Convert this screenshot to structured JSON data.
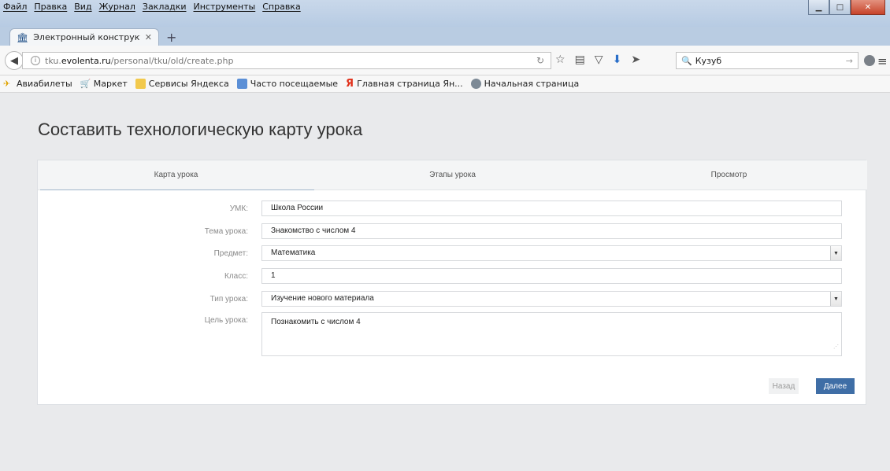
{
  "browser": {
    "menu": [
      "Файл",
      "Правка",
      "Вид",
      "Журнал",
      "Закладки",
      "Инструменты",
      "Справка"
    ],
    "tab_title": "Электронный конструкто...",
    "url_prefix": "tku.",
    "url_domain": "evolenta.ru",
    "url_path": "/personal/tku/old/create.php",
    "search_value": "Кузуб",
    "bookmarks": [
      "Авиабилеты",
      "Маркет",
      "Сервисы Яндекса",
      "Часто посещаемые",
      "Главная страница Ян...",
      "Начальная страница"
    ]
  },
  "page": {
    "title": "Составить технологическую карту урока",
    "tabs": [
      "Карта урока",
      "Этапы урока",
      "Просмотр"
    ],
    "form": {
      "umk_label": "УМК:",
      "umk_value": "Школа России",
      "topic_label": "Тема урока:",
      "topic_value": "Знакомство с числом 4",
      "subject_label": "Предмет:",
      "subject_value": "Математика",
      "class_label": "Класс:",
      "class_value": "1",
      "type_label": "Тип урока:",
      "type_value": "Изучение нового материала",
      "goal_label": "Цель урока:",
      "goal_value": "Познакомить с числом 4"
    },
    "back_label": "Назад",
    "next_label": "Далее"
  },
  "colors": {
    "accent": "#3f6ea6",
    "page_bg": "#e9eaec"
  }
}
